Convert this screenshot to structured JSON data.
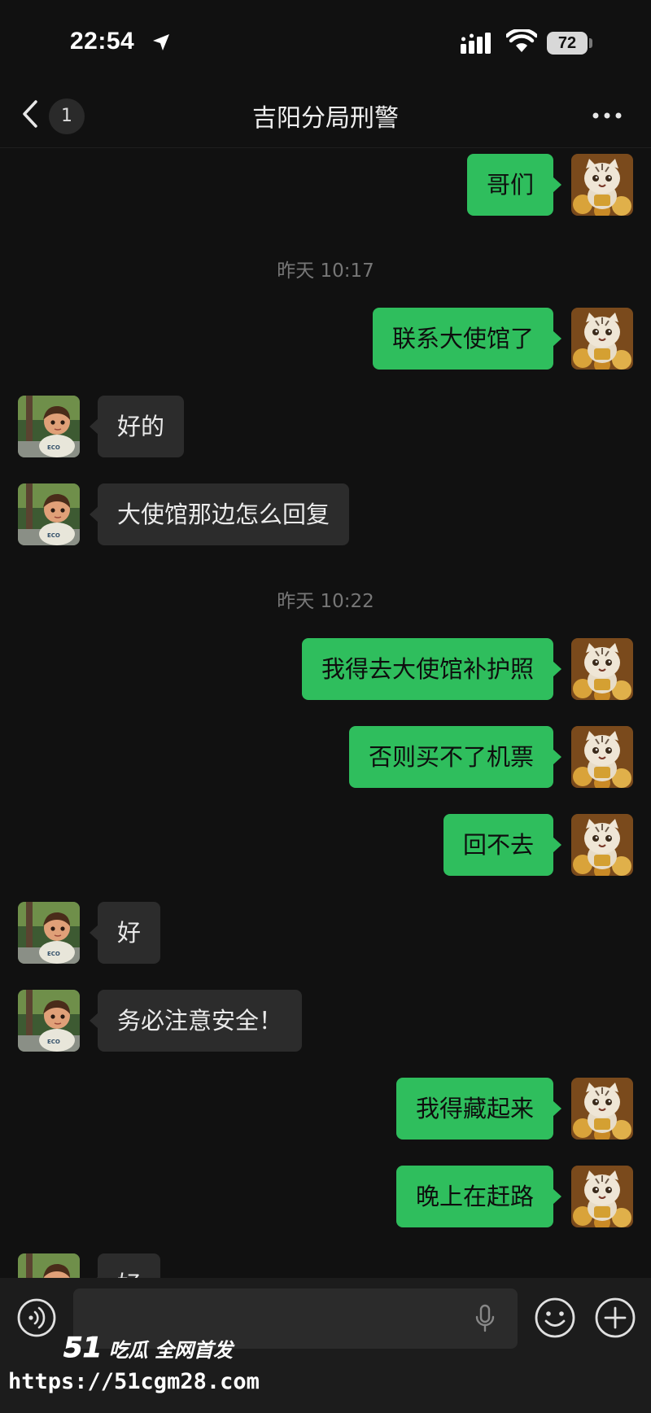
{
  "status_bar": {
    "time": "22:54",
    "battery": "72",
    "icons": [
      "location-arrow-icon",
      "signal-icon",
      "wifi-icon",
      "battery-icon"
    ]
  },
  "nav": {
    "title": "吉阳分局刑警",
    "unread_count": "1",
    "icons": [
      "back-chevron-icon",
      "more-icon"
    ]
  },
  "colors": {
    "background": "#111111",
    "outgoing_bubble": "#2fbe5d",
    "incoming_bubble": "#2c2c2c",
    "timestamp": "#777777"
  },
  "messages": [
    {
      "dir": "out",
      "text": "哥们"
    },
    {
      "type": "time",
      "text": "昨天 10:17"
    },
    {
      "dir": "out",
      "text": "联系大使馆了"
    },
    {
      "dir": "in",
      "text": "好的"
    },
    {
      "dir": "in",
      "text": "大使馆那边怎么回复"
    },
    {
      "type": "time",
      "text": "昨天 10:22"
    },
    {
      "dir": "out",
      "text": "我得去大使馆补护照"
    },
    {
      "dir": "out",
      "text": "否则买不了机票"
    },
    {
      "dir": "out",
      "text": "回不去"
    },
    {
      "dir": "in",
      "text": "好"
    },
    {
      "dir": "in",
      "text": "务必注意安全！"
    },
    {
      "dir": "out",
      "text": "我得藏起来"
    },
    {
      "dir": "out",
      "text": "晚上在赶路"
    },
    {
      "dir": "in",
      "text": "好"
    }
  ],
  "input_bar": {
    "placeholder": "",
    "icons": [
      "voice-icon",
      "mic-icon",
      "emoji-icon",
      "plus-icon"
    ]
  },
  "watermark": {
    "logo_num": "51",
    "logo_text": "吃瓜 全网首发",
    "url": "https://51cgm28.com"
  }
}
